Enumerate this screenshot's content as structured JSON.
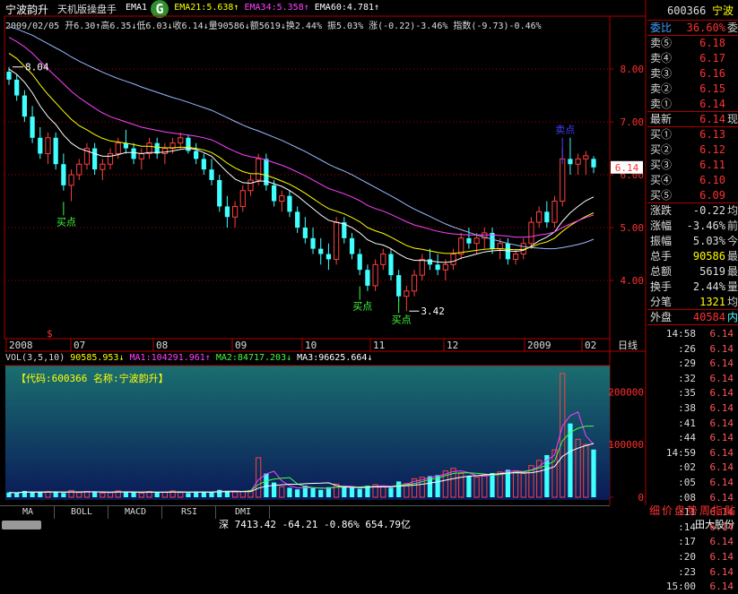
{
  "header": {
    "stock_name": "宁波韵升",
    "software": "天机版操盘手",
    "ema_labels": [
      {
        "text": "EMA1",
        "color": "#ffffff"
      },
      {
        "text": "31↑",
        "color": "#ffffff"
      },
      {
        "text": "EMA21:5.638↑",
        "color": "#ffff00"
      },
      {
        "text": "EMA34:5.358↑",
        "color": "#ff40ff"
      },
      {
        "text": "EMA60:4.781↑",
        "color": "#ffffff"
      }
    ],
    "logo_letter": "G",
    "quote_line": "2009/02/05 开6.30↑高6.35↓低6.03↓收6.14↓量90586↓额5619↓换2.44% 振5.03% 涨(-0.22)-3.46% 指数(-9.73)-0.46%"
  },
  "chart_data": {
    "type": "candlestick",
    "title": "宁波韵升",
    "y_ticks": [
      8.0,
      7.0,
      6.0,
      5.0,
      4.0
    ],
    "ylim": [
      3.0,
      8.9
    ],
    "x_labels": [
      "2008",
      "07",
      "08",
      "09",
      "10",
      "11",
      "12",
      "2009",
      "02"
    ],
    "period_label": "日线",
    "current_price_tag": "6.14",
    "annotations": {
      "high_value": "8.04",
      "low_value": "3.42",
      "buy_label": "买点",
      "sell_label": "卖点",
      "dollar_marker": "$"
    },
    "candles": [
      [
        7.95,
        8.04,
        7.7,
        7.8
      ],
      [
        7.8,
        7.9,
        7.4,
        7.5
      ],
      [
        7.5,
        7.6,
        7.0,
        7.1
      ],
      [
        7.1,
        7.3,
        6.6,
        6.7
      ],
      [
        6.7,
        6.9,
        6.3,
        6.4
      ],
      [
        6.4,
        6.8,
        6.2,
        6.7
      ],
      [
        6.7,
        6.8,
        6.1,
        6.2
      ],
      [
        6.2,
        6.4,
        5.7,
        5.8
      ],
      [
        5.8,
        6.1,
        5.5,
        6.0
      ],
      [
        6.0,
        6.3,
        5.9,
        6.2
      ],
      [
        6.2,
        6.6,
        6.1,
        6.5
      ],
      [
        6.5,
        6.6,
        6.0,
        6.1
      ],
      [
        6.1,
        6.3,
        5.9,
        6.2
      ],
      [
        6.2,
        6.5,
        6.1,
        6.4
      ],
      [
        6.4,
        6.7,
        6.3,
        6.6
      ],
      [
        6.6,
        6.85,
        6.4,
        6.5
      ],
      [
        6.5,
        6.6,
        6.2,
        6.3
      ],
      [
        6.3,
        6.5,
        6.1,
        6.4
      ],
      [
        6.4,
        6.7,
        6.3,
        6.6
      ],
      [
        6.6,
        6.7,
        6.3,
        6.4
      ],
      [
        6.4,
        6.6,
        6.2,
        6.5
      ],
      [
        6.5,
        6.7,
        6.4,
        6.6
      ],
      [
        6.6,
        6.8,
        6.5,
        6.7
      ],
      [
        6.7,
        6.75,
        6.4,
        6.45
      ],
      [
        6.45,
        6.6,
        6.2,
        6.3
      ],
      [
        6.3,
        6.4,
        6.0,
        6.1
      ],
      [
        6.1,
        6.3,
        5.8,
        5.9
      ],
      [
        5.9,
        6.0,
        5.3,
        5.4
      ],
      [
        5.4,
        5.6,
        5.0,
        5.2
      ],
      [
        5.2,
        5.5,
        5.0,
        5.4
      ],
      [
        5.4,
        5.8,
        5.3,
        5.7
      ],
      [
        5.7,
        6.0,
        5.6,
        5.9
      ],
      [
        5.9,
        6.4,
        5.8,
        6.3
      ],
      [
        6.3,
        6.4,
        5.7,
        5.8
      ],
      [
        5.8,
        5.9,
        5.4,
        5.5
      ],
      [
        5.5,
        5.7,
        5.3,
        5.6
      ],
      [
        5.6,
        5.7,
        5.2,
        5.3
      ],
      [
        5.3,
        5.4,
        4.9,
        5.0
      ],
      [
        5.0,
        5.2,
        4.7,
        4.8
      ],
      [
        4.8,
        5.0,
        4.5,
        4.6
      ],
      [
        4.6,
        4.8,
        4.3,
        4.5
      ],
      [
        4.5,
        4.7,
        4.2,
        4.4
      ],
      [
        4.4,
        5.2,
        4.3,
        5.1
      ],
      [
        5.1,
        5.2,
        4.7,
        4.8
      ],
      [
        4.8,
        4.9,
        4.4,
        4.5
      ],
      [
        4.5,
        4.6,
        4.1,
        4.2
      ],
      [
        4.2,
        4.3,
        3.8,
        3.9
      ],
      [
        3.9,
        4.4,
        3.8,
        4.3
      ],
      [
        4.3,
        4.6,
        4.2,
        4.5
      ],
      [
        4.5,
        4.6,
        4.0,
        4.1
      ],
      [
        4.1,
        4.2,
        3.6,
        3.7
      ],
      [
        3.7,
        3.9,
        3.42,
        3.8
      ],
      [
        3.8,
        4.2,
        3.7,
        4.1
      ],
      [
        4.1,
        4.5,
        4.0,
        4.4
      ],
      [
        4.4,
        4.6,
        4.2,
        4.3
      ],
      [
        4.3,
        4.5,
        4.1,
        4.2
      ],
      [
        4.2,
        4.4,
        4.0,
        4.3
      ],
      [
        4.3,
        4.6,
        4.2,
        4.5
      ],
      [
        4.5,
        4.9,
        4.4,
        4.8
      ],
      [
        4.8,
        5.0,
        4.6,
        4.7
      ],
      [
        4.7,
        4.9,
        4.5,
        4.8
      ],
      [
        4.8,
        5.0,
        4.6,
        4.9
      ],
      [
        4.9,
        5.0,
        4.5,
        4.6
      ],
      [
        4.6,
        4.8,
        4.4,
        4.7
      ],
      [
        4.7,
        4.8,
        4.3,
        4.4
      ],
      [
        4.4,
        4.6,
        4.3,
        4.5
      ],
      [
        4.5,
        4.8,
        4.4,
        4.7
      ],
      [
        4.7,
        5.2,
        4.6,
        5.1
      ],
      [
        5.1,
        5.4,
        5.0,
        5.3
      ],
      [
        5.3,
        5.5,
        5.0,
        5.1
      ],
      [
        5.1,
        5.6,
        5.0,
        5.5
      ],
      [
        5.5,
        6.5,
        5.4,
        6.3
      ],
      [
        6.3,
        6.7,
        6.0,
        6.2
      ],
      [
        6.2,
        6.4,
        6.0,
        6.3
      ],
      [
        6.3,
        6.45,
        6.0,
        6.36
      ],
      [
        6.3,
        6.35,
        6.03,
        6.14
      ]
    ],
    "ema_series": [
      {
        "name": "EMA13",
        "color": "#ffffff",
        "values": [
          8.0,
          7.9,
          7.75,
          7.55,
          7.3,
          7.1,
          6.95,
          6.75,
          6.6,
          6.5,
          6.45,
          6.4,
          6.35,
          6.35,
          6.38,
          6.42,
          6.42,
          6.4,
          6.42,
          6.42,
          6.43,
          6.45,
          6.48,
          6.5,
          6.48,
          6.42,
          6.35,
          6.2,
          6.05,
          5.92,
          5.85,
          5.84,
          5.88,
          5.88,
          5.83,
          5.78,
          5.7,
          5.6,
          5.48,
          5.36,
          5.24,
          5.14,
          5.1,
          5.07,
          5.0,
          4.9,
          4.77,
          4.7,
          4.67,
          4.6,
          4.5,
          4.42,
          4.38,
          4.38,
          4.37,
          4.35,
          4.34,
          4.36,
          4.42,
          4.46,
          4.5,
          4.54,
          4.56,
          4.57,
          4.56,
          4.55,
          4.57,
          4.65,
          4.75,
          4.82,
          4.92,
          5.12,
          5.28,
          5.4,
          5.51,
          5.58
        ]
      },
      {
        "name": "EMA21",
        "color": "#ffff00",
        "values": [
          8.3,
          8.2,
          8.05,
          7.9,
          7.7,
          7.52,
          7.36,
          7.2,
          7.05,
          6.93,
          6.85,
          6.76,
          6.69,
          6.64,
          6.62,
          6.6,
          6.57,
          6.54,
          6.54,
          6.52,
          6.51,
          6.51,
          6.52,
          6.52,
          6.5,
          6.47,
          6.42,
          6.33,
          6.22,
          6.13,
          6.06,
          6.02,
          6.02,
          5.99,
          5.94,
          5.88,
          5.82,
          5.74,
          5.65,
          5.55,
          5.45,
          5.36,
          5.31,
          5.26,
          5.19,
          5.11,
          5.0,
          4.94,
          4.89,
          4.82,
          4.74,
          4.66,
          4.61,
          4.59,
          4.56,
          4.53,
          4.51,
          4.51,
          4.53,
          4.55,
          4.57,
          4.59,
          4.6,
          4.6,
          4.59,
          4.58,
          4.59,
          4.63,
          4.69,
          4.73,
          4.8,
          4.93,
          5.04,
          5.13,
          5.21,
          5.28
        ]
      },
      {
        "name": "EMA34",
        "color": "#ff40ff",
        "values": [
          8.6,
          8.52,
          8.42,
          8.3,
          8.15,
          8.0,
          7.86,
          7.72,
          7.58,
          7.46,
          7.36,
          7.26,
          7.17,
          7.1,
          7.05,
          7.0,
          6.95,
          6.9,
          6.87,
          6.84,
          6.81,
          6.79,
          6.77,
          6.75,
          6.73,
          6.7,
          6.66,
          6.59,
          6.51,
          6.44,
          6.38,
          6.34,
          6.32,
          6.28,
          6.23,
          6.18,
          6.12,
          6.05,
          5.98,
          5.9,
          5.82,
          5.74,
          5.69,
          5.64,
          5.58,
          5.51,
          5.42,
          5.36,
          5.31,
          5.25,
          5.18,
          5.11,
          5.05,
          5.01,
          4.97,
          4.93,
          4.9,
          4.88,
          4.87,
          4.86,
          4.86,
          4.86,
          4.86,
          4.85,
          4.84,
          4.82,
          4.82,
          4.83,
          4.86,
          4.88,
          4.92,
          5.0,
          5.07,
          5.13,
          5.19,
          5.24
        ]
      },
      {
        "name": "EMA60",
        "color": "#9ab8ff",
        "values": [
          8.8,
          8.76,
          8.7,
          8.64,
          8.56,
          8.48,
          8.4,
          8.32,
          8.23,
          8.15,
          8.08,
          8.01,
          7.94,
          7.88,
          7.82,
          7.77,
          7.72,
          7.66,
          7.61,
          7.56,
          7.51,
          7.46,
          7.42,
          7.37,
          7.32,
          7.27,
          7.22,
          7.15,
          7.08,
          7.01,
          6.94,
          6.88,
          6.83,
          6.77,
          6.71,
          6.65,
          6.58,
          6.51,
          6.44,
          6.36,
          6.28,
          6.2,
          6.13,
          6.07,
          6.0,
          5.92,
          5.84,
          5.76,
          5.68,
          5.6,
          5.52,
          5.43,
          5.35,
          5.28,
          5.21,
          5.14,
          5.07,
          5.01,
          4.96,
          4.91,
          4.86,
          4.82,
          4.78,
          4.74,
          4.7,
          4.67,
          4.64,
          4.62,
          4.61,
          4.6,
          4.6,
          4.62,
          4.65,
          4.68,
          4.72,
          4.78
        ]
      }
    ],
    "volume": {
      "label": "VOL(3,5,10)",
      "values_line": [
        {
          "text": "90585.953↓",
          "color": "#ffff00"
        },
        {
          "text": "MA1:104291.961↑",
          "color": "#ff40ff"
        },
        {
          "text": "MA2:84717.203↓",
          "color": "#40ff40"
        },
        {
          "text": "MA3:96625.664↓",
          "color": "#ffffff"
        }
      ],
      "overlay_text": "【代码:600366 名称:宁波韵升】",
      "y_ticks": [
        200000,
        100000,
        0
      ],
      "ylim": [
        0,
        250000
      ],
      "bars": [
        9000,
        8000,
        12000,
        10000,
        9000,
        11000,
        10000,
        8000,
        13000,
        9000,
        11000,
        10000,
        8000,
        9000,
        12000,
        10000,
        9000,
        8000,
        11000,
        9000,
        10000,
        12000,
        9000,
        8000,
        11000,
        10000,
        9000,
        14000,
        12000,
        10000,
        11000,
        13000,
        75000,
        45000,
        28000,
        20000,
        18000,
        15000,
        22000,
        17000,
        14000,
        19000,
        25000,
        20000,
        18000,
        16000,
        22000,
        24000,
        20000,
        18000,
        30000,
        26000,
        35000,
        38000,
        40000,
        42000,
        50000,
        55000,
        45000,
        40000,
        38000,
        42000,
        46000,
        48000,
        52000,
        50000,
        45000,
        60000,
        70000,
        80000,
        90000,
        235000,
        140000,
        110000,
        100000,
        90586
      ],
      "ma_series": [
        {
          "name": "MA1",
          "color": "#ff40ff"
        },
        {
          "name": "MA2",
          "color": "#40ff40"
        },
        {
          "name": "MA3",
          "color": "#ffffff"
        }
      ]
    }
  },
  "tabs": [
    "MA",
    "BOLL",
    "MACD",
    "RSI",
    "DMI"
  ],
  "index_bar": "深 7413.42 -64.21 -0.86% 654.79亿",
  "index_bar_right": "田大股份",
  "panel": {
    "code": "600366",
    "name": "宁波",
    "weibi": {
      "label": "委比",
      "value": "36.60%",
      "extra": "委"
    },
    "asks": [
      {
        "label": "卖⑤",
        "price": "6.18",
        "vol": ""
      },
      {
        "label": "卖④",
        "price": "6.17",
        "vol": ""
      },
      {
        "label": "卖③",
        "price": "6.16",
        "vol": ""
      },
      {
        "label": "卖②",
        "price": "6.15",
        "vol": ""
      },
      {
        "label": "卖①",
        "price": "6.14",
        "vol": ""
      }
    ],
    "last": {
      "label": "最新",
      "value": "6.14",
      "extra": "现"
    },
    "bids": [
      {
        "label": "买①",
        "price": "6.13",
        "vol": ""
      },
      {
        "label": "买②",
        "price": "6.12",
        "vol": ""
      },
      {
        "label": "买③",
        "price": "6.11",
        "vol": ""
      },
      {
        "label": "买④",
        "price": "6.10",
        "vol": ""
      },
      {
        "label": "买⑤",
        "price": "6.09",
        "vol": ""
      }
    ],
    "stats": [
      {
        "label": "涨跌",
        "value": "-0.22",
        "extra": "均"
      },
      {
        "label": "涨幅",
        "value": "-3.46%",
        "extra": "前"
      },
      {
        "label": "振幅",
        "value": "5.03%",
        "extra": "今"
      },
      {
        "label": "总手",
        "value": "90586",
        "extra": "最"
      },
      {
        "label": "总额",
        "value": "5619",
        "extra": "最"
      },
      {
        "label": "换手",
        "value": "2.44%",
        "extra": "量"
      },
      {
        "label": "分笔",
        "value": "1321",
        "extra": "均"
      }
    ],
    "outer": {
      "label": "外盘",
      "value": "40584",
      "extra": "内"
    },
    "ticks": [
      {
        "time": "14:58",
        "price": "6.14"
      },
      {
        "time": ":26",
        "price": "6.14"
      },
      {
        "time": ":29",
        "price": "6.14"
      },
      {
        "time": ":32",
        "price": "6.14"
      },
      {
        "time": ":35",
        "price": "6.14"
      },
      {
        "time": ":38",
        "price": "6.14"
      },
      {
        "time": ":41",
        "price": "6.14"
      },
      {
        "time": ":44",
        "price": "6.14"
      },
      {
        "time": "14:59",
        "price": "6.14"
      },
      {
        "time": ":02",
        "price": "6.14"
      },
      {
        "time": ":05",
        "price": "6.14"
      },
      {
        "time": ":08",
        "price": "6.14"
      },
      {
        "time": ":11",
        "price": "6.14"
      },
      {
        "time": ":14",
        "price": "6.14"
      },
      {
        "time": ":17",
        "price": "6.14"
      },
      {
        "time": ":20",
        "price": "6.14"
      },
      {
        "time": ":23",
        "price": "6.14"
      },
      {
        "time": "15:00",
        "price": "6.14"
      }
    ],
    "footer_tabs": [
      "细",
      "价",
      "盘",
      "势",
      "周",
      "指",
      "贴"
    ]
  },
  "colors": {
    "up": "#ff4040",
    "down": "#40ffff",
    "axis": "#b00000",
    "label_red": "#ff3030",
    "panel_yellow": "#ffff00"
  }
}
